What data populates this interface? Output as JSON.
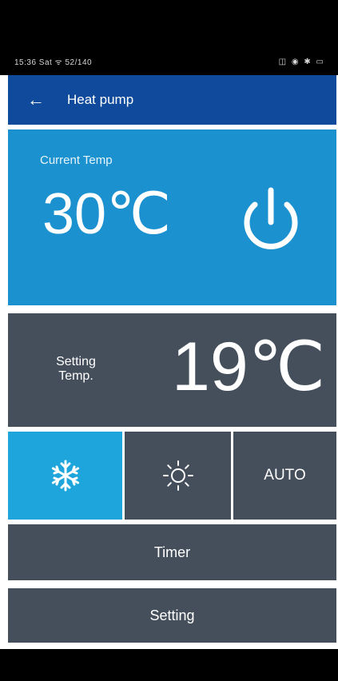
{
  "status_bar": {
    "left_text": "15:36 Sat ᯤ 52/140",
    "right_icons": "◫ ◉ ✱ ▭"
  },
  "app_bar": {
    "back_icon": "←",
    "title": "Heat pump"
  },
  "current": {
    "label": "Current Temp",
    "temperature": "30℃"
  },
  "setting": {
    "label": "Setting Temp.",
    "temperature": "19℃"
  },
  "modes": {
    "cool_icon": "snowflake-icon",
    "heat_icon": "sun-icon",
    "auto_label": "AUTO",
    "selected": "cool"
  },
  "buttons": {
    "timer": "Timer",
    "setting": "Setting"
  },
  "colors": {
    "app_bar": "#0f4a9c",
    "current_panel": "#1b92cf",
    "dark_panel": "#454f5c",
    "selected_mode": "#1ea6dc"
  }
}
